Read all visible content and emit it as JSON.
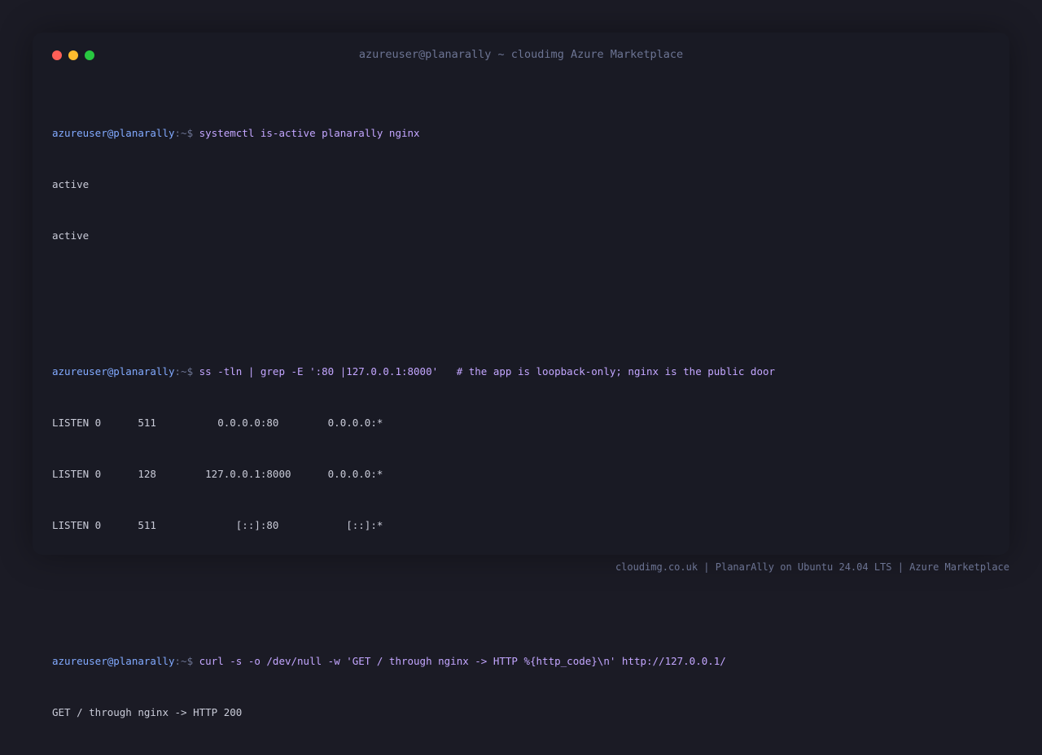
{
  "window": {
    "title": "azureuser@planarally ~ cloudimg Azure Marketplace",
    "controls": [
      {
        "name": "close",
        "color": "#ff5f57"
      },
      {
        "name": "minimize",
        "color": "#febc2e"
      },
      {
        "name": "maximize",
        "color": "#28c840"
      }
    ]
  },
  "prompt": {
    "user_host": "azureuser@planarally",
    "path_symbol": ":~$"
  },
  "blocks": [
    {
      "command": "systemctl is-active planarally nginx",
      "output": [
        "active",
        "active"
      ]
    },
    {
      "command": "ss -tln | grep -E ':80 |127.0.0.1:8000'   # the app is loopback-only; nginx is the public door",
      "output": [
        "LISTEN 0      511          0.0.0.0:80        0.0.0.0:*",
        "LISTEN 0      128        127.0.0.1:8000      0.0.0.0:*",
        "LISTEN 0      511             [::]:80           [::]:*"
      ]
    },
    {
      "command": "curl -s -o /dev/null -w 'GET / through nginx -> HTTP %{http_code}\\n' http://127.0.0.1/",
      "output": [
        "GET / through nginx -> HTTP 200"
      ]
    }
  ],
  "footer": "cloudimg.co.uk | PlanarAlly on Ubuntu 24.04 LTS | Azure Marketplace",
  "colors": {
    "background": "#1b1b25",
    "window": "#191a24",
    "user": "#82aaff",
    "command": "#c3a6ff",
    "output": "#c9cbd8",
    "muted": "#6c7493"
  }
}
